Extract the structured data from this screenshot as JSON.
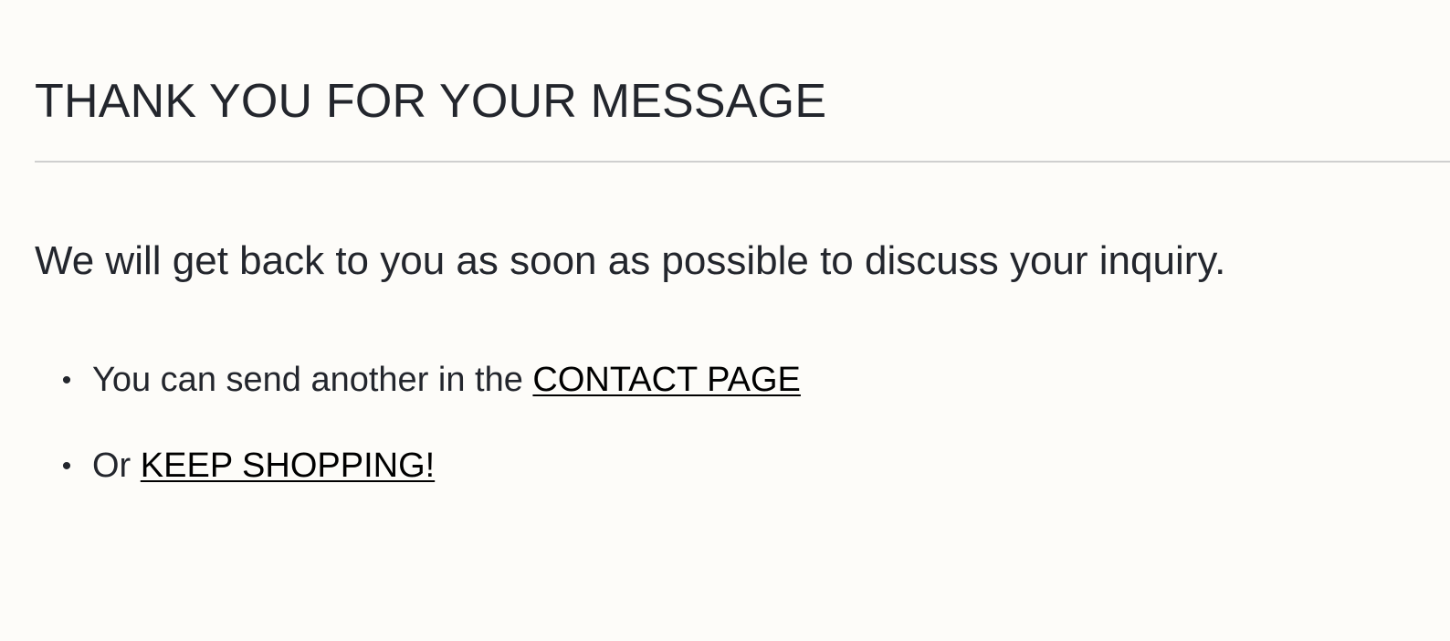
{
  "page": {
    "title": "THANK YOU FOR YOUR MESSAGE",
    "message": "We will get back to you as soon as possible to discuss your inquiry."
  },
  "options": {
    "contact": {
      "prefix": "You can send another in the ",
      "link_label": "CONTACT PAGE"
    },
    "shopping": {
      "prefix": "Or ",
      "link_label": "KEEP SHOPPING!"
    }
  },
  "colors": {
    "background": "#fdfcf9",
    "text": "#23262d",
    "link": "#000000",
    "divider": "#cfcfcf"
  }
}
